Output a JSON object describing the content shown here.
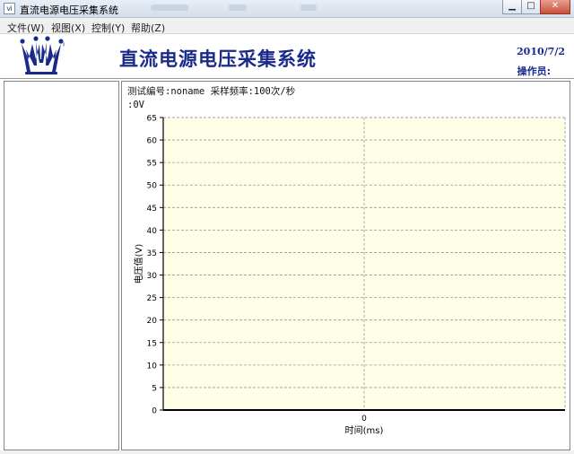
{
  "window": {
    "title": "直流电源电压采集系统",
    "icon": "app-icon",
    "controls": [
      "minimize-icon",
      "maximize-icon",
      "close-icon"
    ]
  },
  "menu": {
    "items": [
      {
        "label": "文件(W)"
      },
      {
        "label": "视图(X)"
      },
      {
        "label": "控制(Y)"
      },
      {
        "label": "帮助(Z)"
      }
    ]
  },
  "header": {
    "title": "直流电源电压采集系统",
    "date": "2010/7/2",
    "operator_label": "操作员:",
    "logo": "crown-logo-icon",
    "colors": {
      "brand": "#1a2a8a"
    }
  },
  "info": {
    "test_line": "测试编号:noname   采样频率:100次/秒",
    "voltage_line": ":0V"
  },
  "chart_data": {
    "type": "line",
    "series": [],
    "x_ticks": [
      "0"
    ],
    "y_ticks": [
      "0",
      "5",
      "10",
      "15",
      "20",
      "25",
      "30",
      "35",
      "40",
      "45",
      "50",
      "55",
      "60",
      "65"
    ],
    "ylim": [
      0,
      65
    ],
    "xlabel": "时间(ms)",
    "ylabel": "电压值(V)",
    "grid": true,
    "grid_style": "dashed",
    "colors": {
      "plot_background": "#ffffe8",
      "grid": "#9a9a9a",
      "axis": "#000000"
    }
  }
}
